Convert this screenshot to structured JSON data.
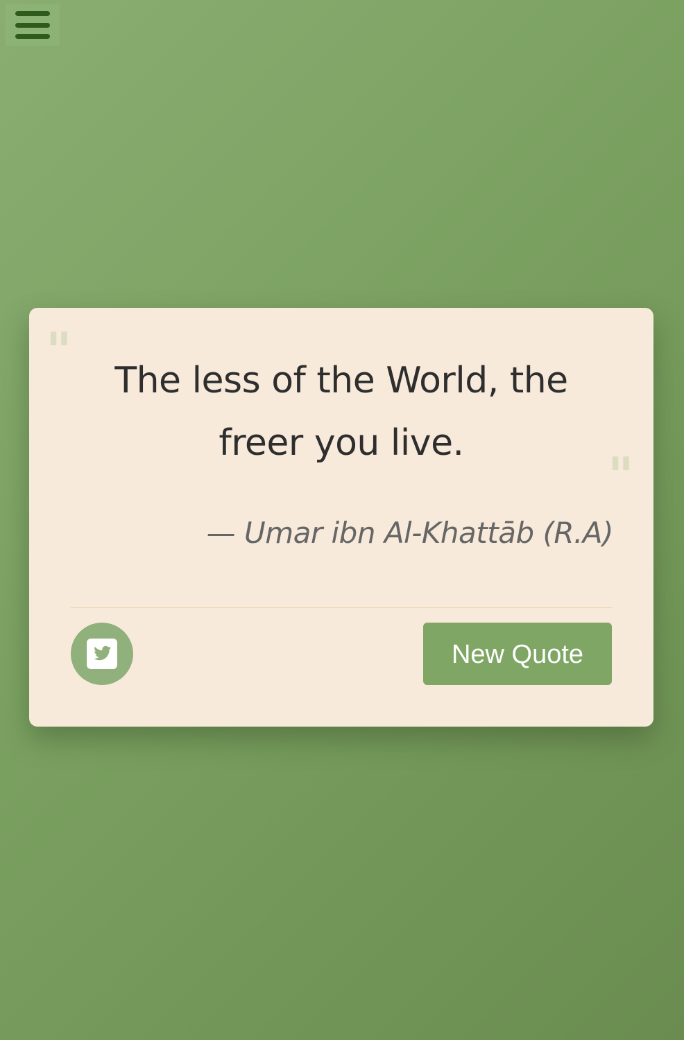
{
  "header": {
    "menu_icon": "hamburger-menu-icon"
  },
  "quote_card": {
    "open_quote_mark": "\"",
    "close_quote_mark": "\"",
    "text": "The less of the World, the freer you live.",
    "author": "— Umar ibn Al-Khattāb (R.A)",
    "tweet_icon": "twitter-icon",
    "new_quote_label": "New Quote"
  },
  "colors": {
    "background": "#7aa060",
    "card": "#f7eadb",
    "accent": "#7fa664",
    "menu_bars": "#2f5a1e"
  }
}
